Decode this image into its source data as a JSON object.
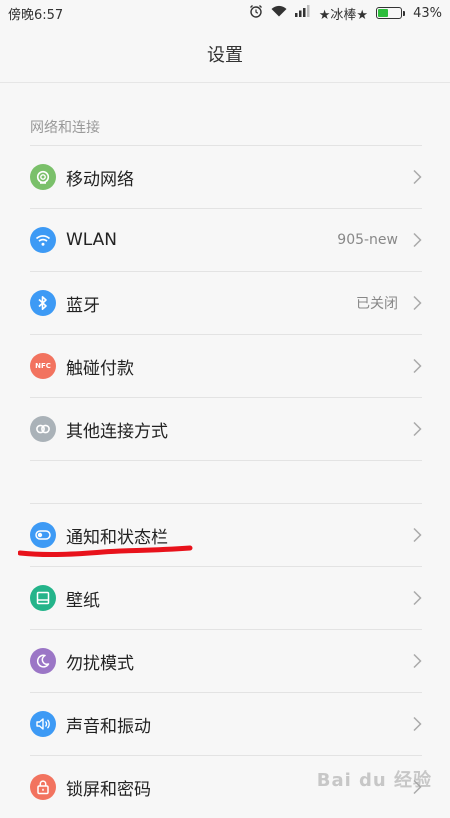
{
  "status_bar": {
    "time": "傍晚6:57",
    "carrier": "★冰棒★",
    "battery_percent": "43%",
    "battery_level": 0.43,
    "icons": [
      "alarm-icon",
      "wifi-icon",
      "signal-icon",
      "battery-icon"
    ]
  },
  "header": {
    "title": "设置"
  },
  "sections": [
    {
      "title": "网络和连接",
      "items": [
        {
          "label": "移动网络",
          "value": "",
          "icon": "mobile-network-icon",
          "color": "#7ac06a"
        },
        {
          "label": "WLAN",
          "value": "905-new",
          "icon": "wifi-icon",
          "color": "#3d9af5"
        },
        {
          "label": "蓝牙",
          "value": "已关闭",
          "icon": "bluetooth-icon",
          "color": "#3d9af5"
        },
        {
          "label": "触碰付款",
          "value": "",
          "icon": "nfc-icon",
          "color": "#f2735f",
          "icon_text": "NFC"
        },
        {
          "label": "其他连接方式",
          "value": "",
          "icon": "link-icon",
          "color": "#aab2b8"
        }
      ]
    },
    {
      "title": "",
      "items": [
        {
          "label": "通知和状态栏",
          "value": "",
          "icon": "toggle-icon",
          "color": "#3d9af5"
        },
        {
          "label": "壁纸",
          "value": "",
          "icon": "wallpaper-icon",
          "color": "#24b48a"
        },
        {
          "label": "勿扰模式",
          "value": "",
          "icon": "moon-icon",
          "color": "#9b76c6"
        },
        {
          "label": "声音和振动",
          "value": "",
          "icon": "speaker-icon",
          "color": "#3d9af5"
        },
        {
          "label": "锁屏和密码",
          "value": "",
          "icon": "lock-icon",
          "color": "#f2735f"
        }
      ]
    }
  ],
  "watermark": "Bai du 经验",
  "annotation_color": "#e8121b"
}
